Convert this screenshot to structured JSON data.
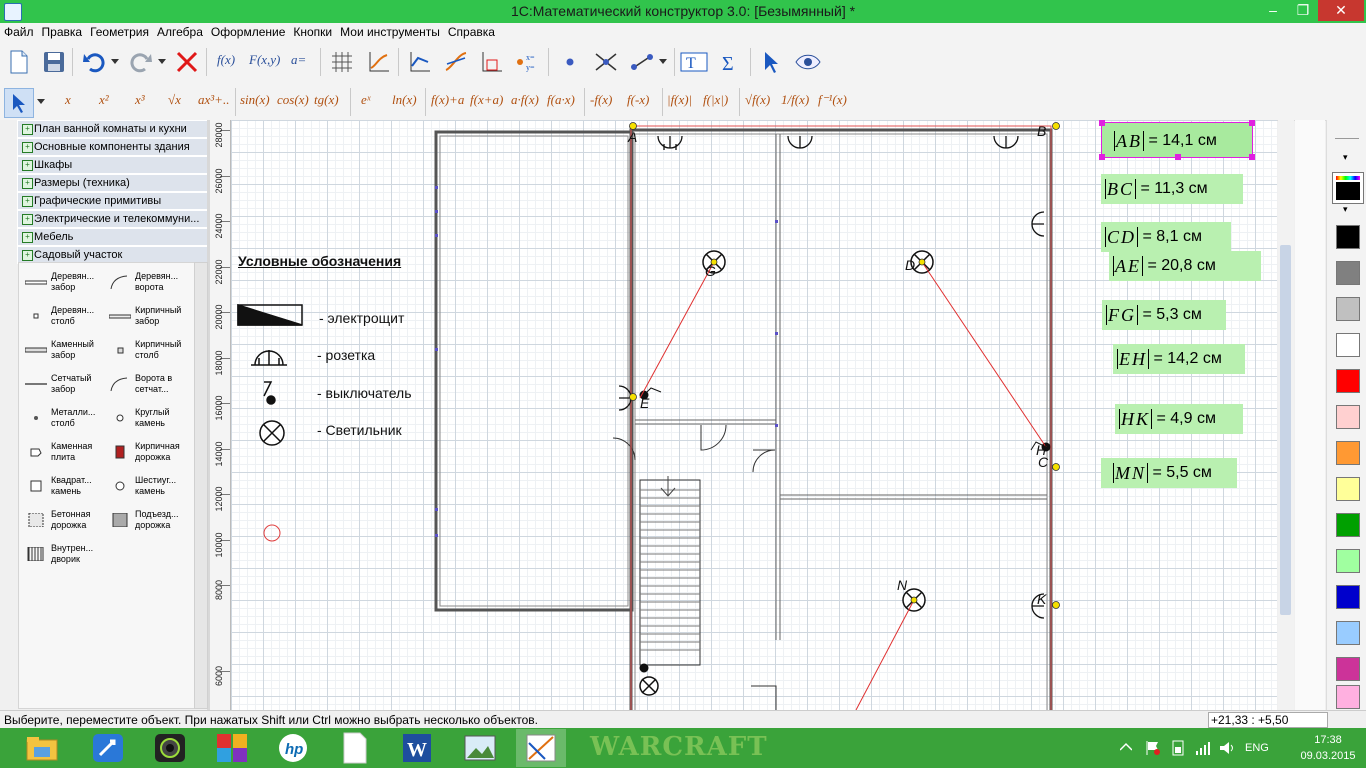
{
  "window": {
    "title": "1С:Математический конструктор 3.0: [Безымянный] *",
    "minimize": "–",
    "restore": "❐",
    "close": "✕"
  },
  "menu": [
    "Файл",
    "Правка",
    "Геометрия",
    "Алгебра",
    "Оформление",
    "Кнопки",
    "Мои инструменты",
    "Справка"
  ],
  "toolbar2": {
    "functions": [
      "x",
      "x²",
      "x³",
      "√x",
      "ax³+..",
      "sin(x)",
      "cos(x)",
      "tg(x)",
      "eˣ",
      "ln(x)",
      "f(x)+a",
      "f(x+a)",
      "a·f(x)",
      "f(a·x)",
      "-f(x)",
      "f(-x)",
      "|f(x)|",
      "f(|x|)",
      "√f(x)",
      "1/f(x)",
      "f⁻¹(x)"
    ],
    "toolbar1_fx": [
      "f(x)",
      "F(x,y)",
      "a="
    ]
  },
  "categories": [
    "План ванной комнаты и кухни",
    "Основные компоненты здания",
    "Шкафы",
    "Размеры (техника)",
    "Графические примитивы",
    "Электрические и телекоммуни...",
    "Мебель",
    "Садовый участок"
  ],
  "palette": [
    {
      "label": "Деревян... забор",
      "icon": "wood-fence-icon"
    },
    {
      "label": "Деревян... ворота",
      "icon": "wood-gate-icon"
    },
    {
      "label": "Деревян... столб",
      "icon": "wood-post-icon"
    },
    {
      "label": "Кирпичный забор",
      "icon": "brick-fence-icon"
    },
    {
      "label": "Каменный забор",
      "icon": "stone-fence-icon"
    },
    {
      "label": "Кирпичный столб",
      "icon": "brick-post-icon"
    },
    {
      "label": "Сетчатый забор",
      "icon": "mesh-fence-icon"
    },
    {
      "label": "Ворота в сетчат...",
      "icon": "mesh-gate-icon"
    },
    {
      "label": "Металли... столб",
      "icon": "metal-post-icon"
    },
    {
      "label": "Круглый камень",
      "icon": "round-stone-icon"
    },
    {
      "label": "Каменная плита",
      "icon": "stone-slab-icon"
    },
    {
      "label": "Кирпичная дорожка",
      "icon": "brick-path-icon"
    },
    {
      "label": "Квадрат... камень",
      "icon": "square-stone-icon"
    },
    {
      "label": "Шестиуг... камень",
      "icon": "hex-stone-icon"
    },
    {
      "label": "Бетонная дорожка",
      "icon": "concrete-path-icon"
    },
    {
      "label": "Подъезд... дорожка",
      "icon": "driveway-icon"
    },
    {
      "label": "Внутрен... дворик",
      "icon": "courtyard-icon"
    }
  ],
  "ruler": [
    "28000",
    "26000",
    "24000",
    "22000",
    "20000",
    "18000",
    "16000",
    "14000",
    "12000",
    "10000",
    "8000",
    "6000"
  ],
  "legend": {
    "title": "Условные обозначения",
    "items": [
      "- электрощит",
      "- розетка",
      "- выключатель",
      "- Светильник"
    ]
  },
  "points": [
    "A",
    "B",
    "C",
    "D",
    "E",
    "G",
    "H",
    "K",
    "N"
  ],
  "measurements": [
    {
      "seg": "AB",
      "value": "= 14,1 см",
      "selected": true
    },
    {
      "seg": "BC",
      "value": "= 11,3 см"
    },
    {
      "seg": "CD",
      "value": "= 8,1 см"
    },
    {
      "seg": "AE",
      "value": "= 20,8 см"
    },
    {
      "seg": "FG",
      "value": "= 5,3 см"
    },
    {
      "seg": "EH",
      "value": "= 14,2 см"
    },
    {
      "seg": "HK",
      "value": "= 4,9 см"
    },
    {
      "seg": "MN",
      "value": "= 5,5 см"
    }
  ],
  "colors": [
    "#000000",
    "#808080",
    "#c0c0c0",
    "#ffffff",
    "#ff0000",
    "#ffd0d0",
    "#ff9933",
    "#ffff99",
    "#00a000",
    "#a0ffa0",
    "#0000cc",
    "#99ccff",
    "#cc3399",
    "#ffb0e0"
  ],
  "accent": {
    "titlebar": "#31c44c",
    "taskbar": "#3aa33a",
    "measure_bg": "#b9f0b0",
    "selection": "#e020e0",
    "wire": "#e03030"
  },
  "status": {
    "message": "Выберите, переместите объект. При нажатых Shift или Ctrl можно выбрать несколько объектов.",
    "coords": "+21,33 : +5,50"
  },
  "taskbar": {
    "apps": [
      "file-explorer-icon",
      "rocket-app-icon",
      "camera-app-icon",
      "puzzle-app-icon",
      "hp-icon",
      "document-icon",
      "word-icon",
      "photo-viewer-icon",
      "math-constructor-icon"
    ],
    "wallpaper": "WARCRAFT",
    "lang": "ENG",
    "time": "17:38",
    "date": "09.03.2015"
  }
}
